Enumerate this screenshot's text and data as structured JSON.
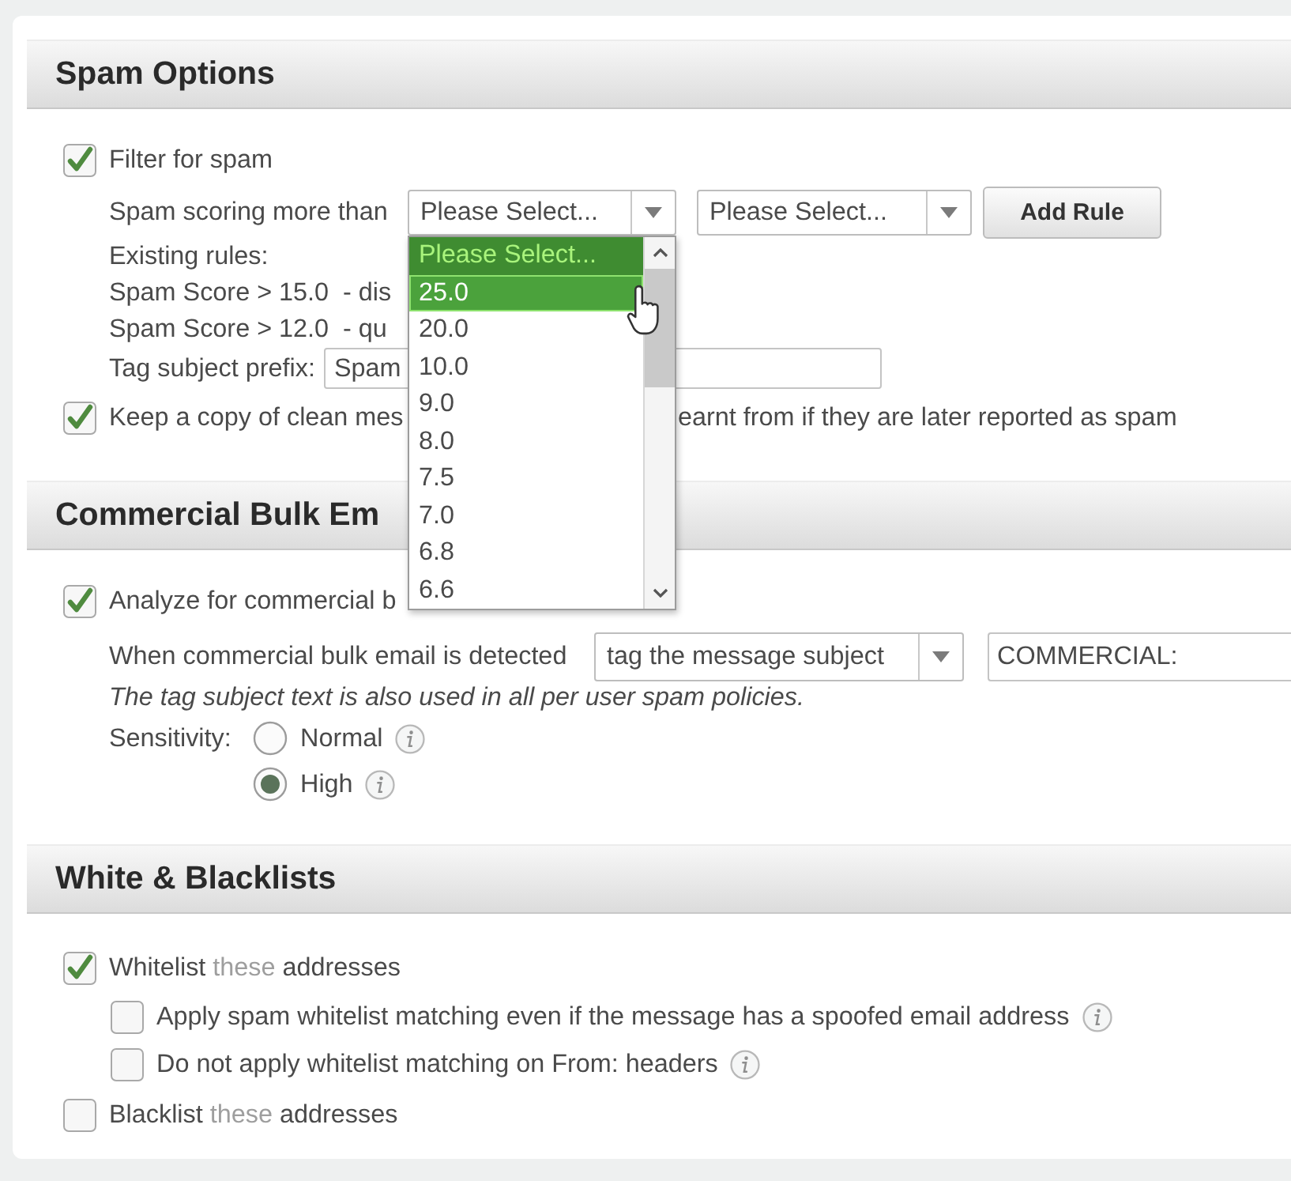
{
  "spam_options": {
    "title": "Spam Options",
    "filter": {
      "label": "Filter for spam",
      "checked": true
    },
    "scoring": {
      "label": "Spam scoring more than",
      "score_select": {
        "value": "Please Select...",
        "expanded": true,
        "options": [
          {
            "label": "Please Select...",
            "selected": true,
            "hovered": false
          },
          {
            "label": "25.0",
            "selected": false,
            "hovered": true
          },
          {
            "label": "20.0",
            "selected": false,
            "hovered": false
          },
          {
            "label": "10.0",
            "selected": false,
            "hovered": false
          },
          {
            "label": "9.0",
            "selected": false,
            "hovered": false
          },
          {
            "label": "8.0",
            "selected": false,
            "hovered": false
          },
          {
            "label": "7.5",
            "selected": false,
            "hovered": false
          },
          {
            "label": "7.0",
            "selected": false,
            "hovered": false
          },
          {
            "label": "6.8",
            "selected": false,
            "hovered": false
          },
          {
            "label": "6.6",
            "selected": false,
            "hovered": false
          }
        ]
      },
      "action_select": {
        "value": "Please Select..."
      },
      "button": "Add Rule"
    },
    "existing_rules": {
      "label": "Existing rules:",
      "rules": [
        "Spam Score > 15.0  - dis",
        "Spam Score > 12.0  - qu"
      ]
    },
    "tag_prefix": {
      "label": "Tag subject prefix:",
      "value": "Spam"
    },
    "keep_copy": {
      "checked": true,
      "label_start": "Keep a copy of clean mes",
      "label_end": "earnt from if they are later reported as spam"
    }
  },
  "commercial_bulk": {
    "title": "Commercial Bulk Em",
    "analyze": {
      "label": "Analyze for commercial b",
      "checked": true
    },
    "action": {
      "label": "When commercial bulk email is detected",
      "select_value": "tag the message subject",
      "tag_value": "COMMERCIAL:"
    },
    "note": "The tag subject text is also used in all per user spam policies.",
    "sensitivity": {
      "label": "Sensitivity:",
      "options": [
        {
          "label": "Normal",
          "selected": false
        },
        {
          "label": "High",
          "selected": true
        }
      ]
    }
  },
  "lists": {
    "title": "White & Blacklists",
    "items": [
      {
        "label": "Whitelist",
        "link": "these",
        "label_end": "addresses",
        "checked": true,
        "children": [
          {
            "label": "Apply spam whitelist matching even if the message has a spoofed email address",
            "checked": false
          },
          {
            "label": "Do not apply whitelist matching on From: headers",
            "checked": false
          }
        ]
      },
      {
        "label": "Blacklist",
        "link": "these",
        "label_end": "addresses",
        "checked": false
      }
    ]
  }
}
